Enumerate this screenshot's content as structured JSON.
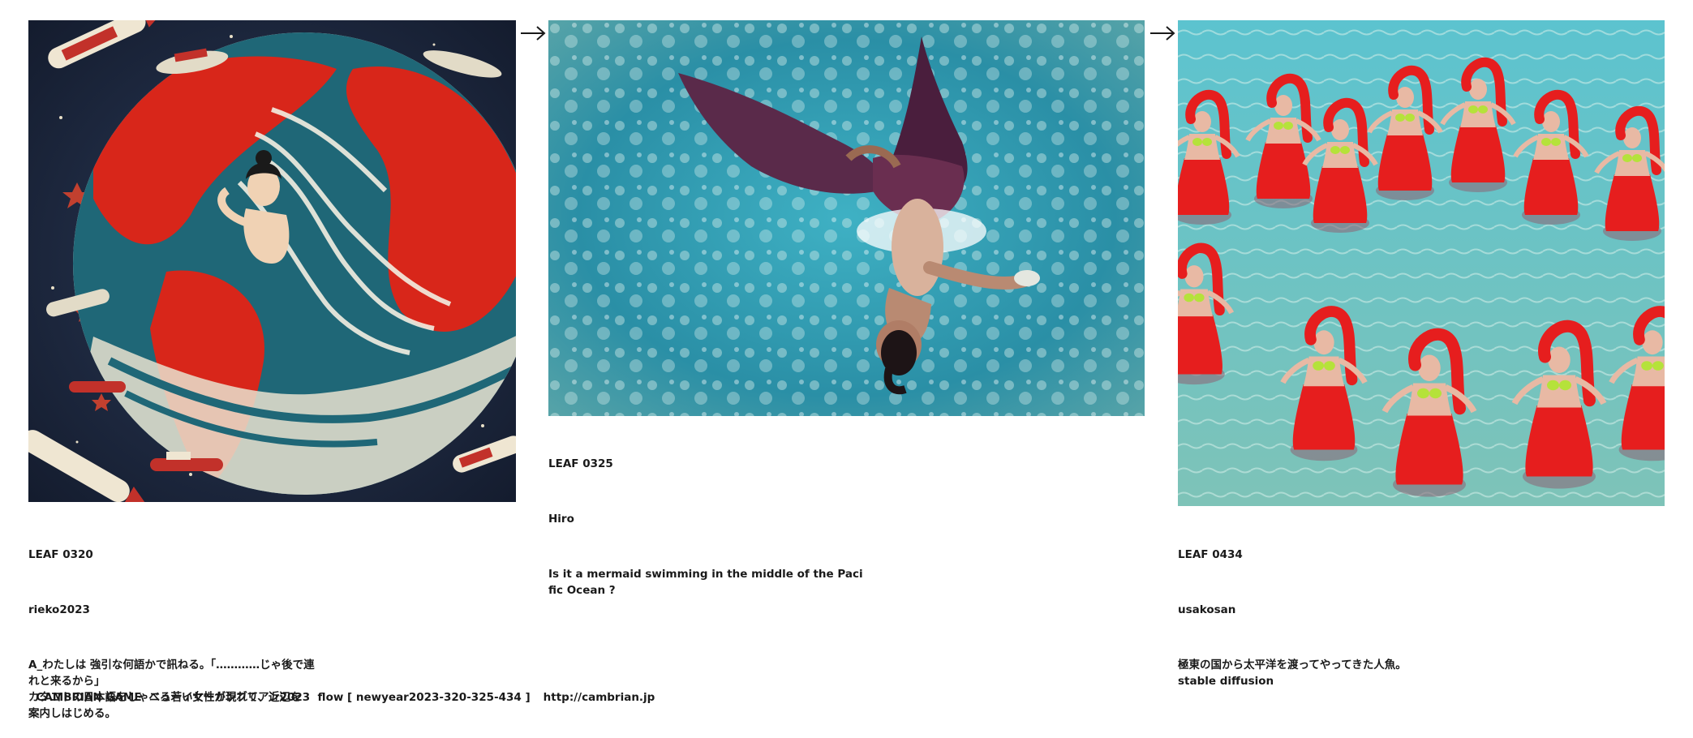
{
  "leaves": [
    {
      "id": "LEAF 0320",
      "author": "rieko2023",
      "caption": "A_わたしは 強引な何語かで訊ねる。「…………じゃ後で連\nれと来るから」\nカタコトの日本語をしゃべる若い女性が現れて、近辺を\n案内しはじめる。",
      "image_icon": "retro-globe-woman-spaceships-image"
    },
    {
      "id": "LEAF 0325",
      "author": "Hiro",
      "caption": "Is it a mermaid swimming in the middle of the Paci\nfic Ocean ?",
      "image_icon": "mermaid-swimming-ocean-image"
    },
    {
      "id": "LEAF 0434",
      "author": "usakosan",
      "caption": "極東の国から太平洋を渡ってやってきた人魚。\nstable diffusion",
      "image_icon": "red-mermaids-circle-dance-image"
    }
  ],
  "arrows": [
    "arrow-right-icon",
    "arrow-right-icon"
  ],
  "footer": {
    "title": "CAMBRIAN GAME  ニューイヤーカンブリアン2023  flow [ newyear2023-320-325-434 ]",
    "url": "http://cambrian.jp"
  },
  "colors": {
    "text": "#1a1a1a",
    "red": "#d8261a",
    "ocean": "#2a8fa6",
    "navy": "#1c2a45"
  }
}
